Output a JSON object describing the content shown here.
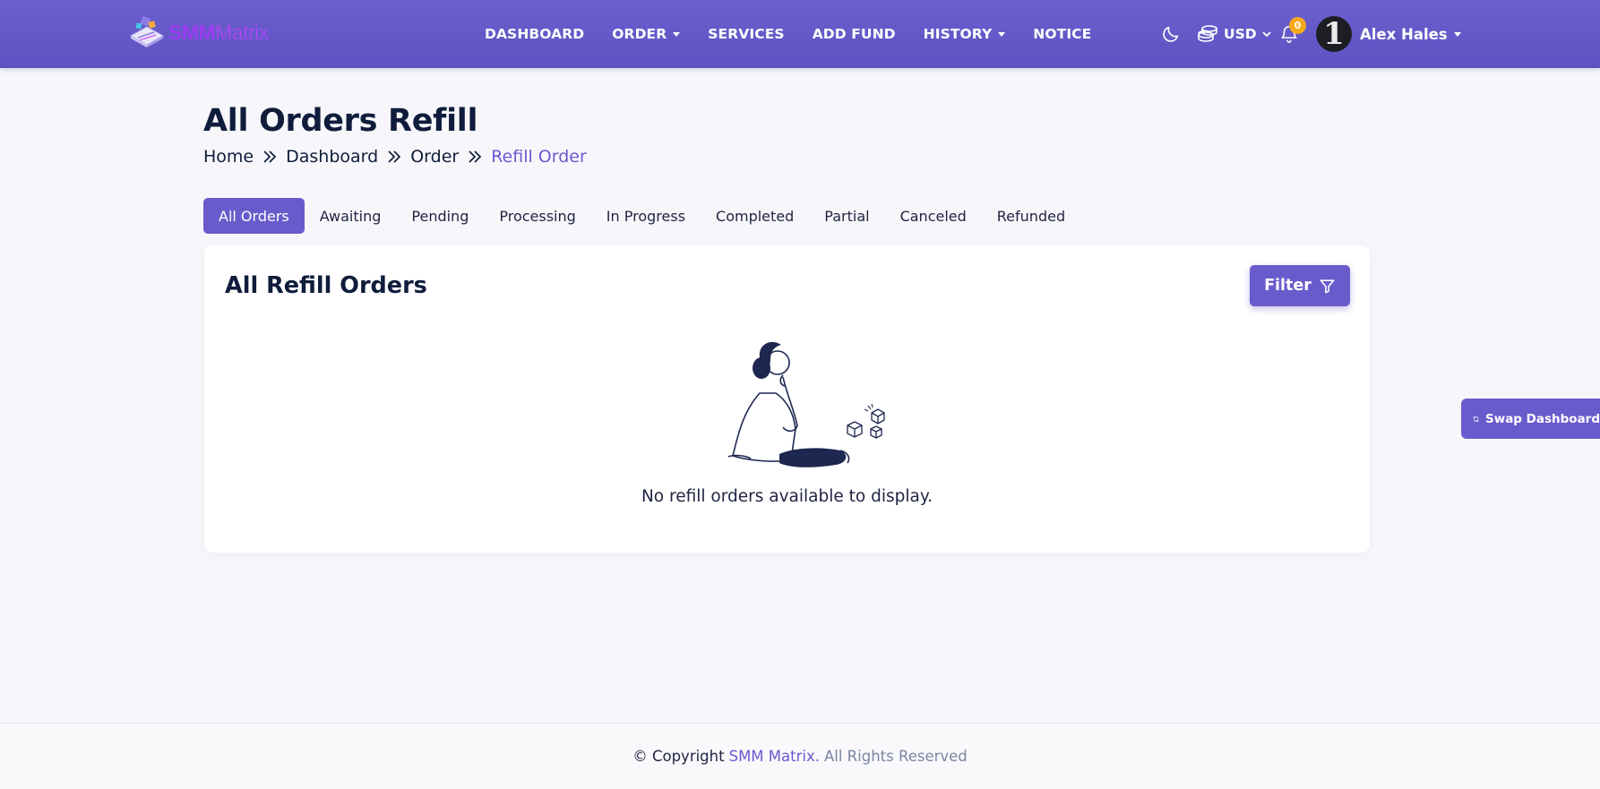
{
  "brand": {
    "logo_text_1": "SMM",
    "logo_text_2": "Matrix"
  },
  "nav": {
    "items": [
      {
        "label": "DASHBOARD",
        "dropdown": false
      },
      {
        "label": "ORDER",
        "dropdown": true
      },
      {
        "label": "SERVICES",
        "dropdown": false
      },
      {
        "label": "ADD FUND",
        "dropdown": false
      },
      {
        "label": "HISTORY",
        "dropdown": true
      },
      {
        "label": "NOTICE",
        "dropdown": false
      }
    ],
    "currency": "USD",
    "notification_count": "0",
    "avatar_glyph": "1",
    "user_name": "Alex Hales"
  },
  "page": {
    "title": "All Orders Refill",
    "breadcrumb": [
      "Home",
      "Dashboard",
      "Order",
      "Refill Order"
    ]
  },
  "tabs": [
    "All Orders",
    "Awaiting",
    "Pending",
    "Processing",
    "In Progress",
    "Completed",
    "Partial",
    "Canceled",
    "Refunded"
  ],
  "card": {
    "title": "All Refill Orders",
    "filter_label": "Filter",
    "empty_text": "No refill orders available to display."
  },
  "swap_label": "Swap Dashboard",
  "footer": {
    "prefix": "© Copyright",
    "brand": "SMM Matrix.",
    "suffix": "All Rights Reserved"
  },
  "colors": {
    "primary": "#6a5bcd",
    "navbar": "#6c60cf",
    "badge": "#f6a91b",
    "heading": "#0f1c3b"
  },
  "icons": [
    "logo-icon",
    "moon-icon",
    "coins-icon",
    "chevron-down-icon",
    "bell-icon",
    "double-chevron-right-icon",
    "filter-icon",
    "refresh-icon"
  ]
}
